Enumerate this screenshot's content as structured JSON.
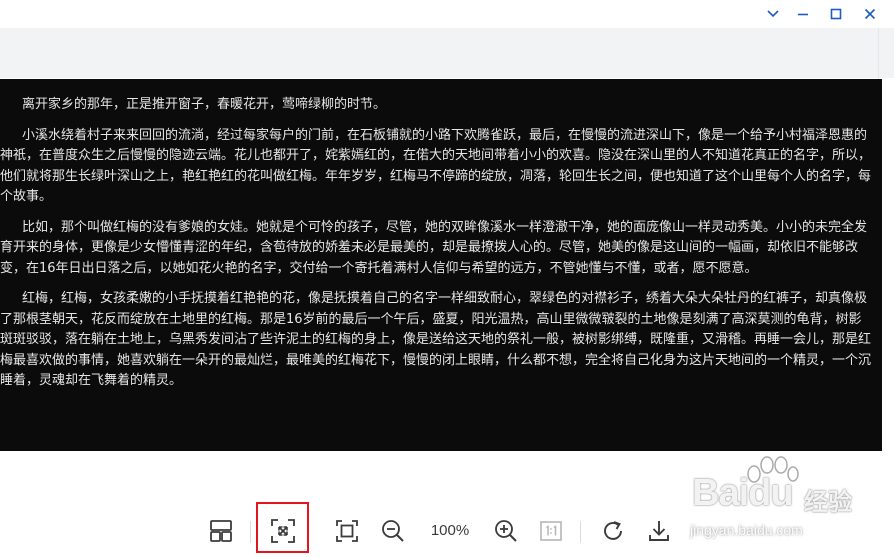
{
  "window": {
    "buttons": [
      "collapse",
      "minimize",
      "maximize",
      "close"
    ]
  },
  "image_text": {
    "paragraphs": [
      "离开家乡的那年，正是推开窗子，春暖花开，莺啼绿柳的时节。",
      "小溪水绕着村子来来回回的流淌，经过每家每户的门前，在石板铺就的小路下欢腾雀跃，最后，在慢慢的流进深山下，像是一个给予小村福泽恩惠的神祇，在普度众生之后慢慢的隐迹云端。花儿也都开了，姹紫嫣红的，在偌大的天地间带着小小的欢喜。隐没在深山里的人不知道花真正的名字，所以，他们就将那生长绿叶深山之上，艳红艳红的花叫做红梅。年年岁岁，红梅马不停蹄的绽放，凋落，轮回生长之间，便也知道了这个山里每个人的名字，每个故事。",
      "比如，那个叫做红梅的没有爹娘的女娃。她就是个可怜的孩子，尽管，她的双眸像溪水一样澄澈干净，她的面庞像山一样灵动秀美。小小的未完全发育开来的身体，更像是少女懵懂青涩的年纪，含苞待放的娇羞未必是最美的，却是最撩拨人心的。尽管，她美的像是这山间的一幅画，却依旧不能够改变，在16年日出日落之后，以她如花火艳的名字，交付给一个寄托着满村人信仰与希望的远方，不管她懂与不懂，或者，愿不愿意。",
      "红梅，红梅，女孩柔嫩的小手抚摸着红艳艳的花，像是抚摸着自己的名字一样细致耐心，翠绿色的对襟衫子，绣着大朵大朵牡丹的红裤子，却真像极了那根茎朝天，花反而绽放在土地里的红梅。那是16岁前的最后一个午后，盛夏，阳光温热，高山里微微皲裂的土地像是刻满了高深莫测的龟背，树影斑斑驳驳，落在躺在土地上，乌黑秀发间沾了些许泥土的红梅的身上，像是送给这天地的祭礼一般，被树影绑缚，既隆重，又滑稽。再睡一会儿，那是红梅最喜欢做的事情，她喜欢躺在一朵开的最灿烂，最唯美的红梅花下，慢慢的闭上眼睛，什么都不想，完全将自己化身为这片天地间的一个精灵，一个沉睡着，灵魂却在飞舞着的精灵。"
    ]
  },
  "toolbar": {
    "zoom_level": "100%",
    "icons": [
      "layout-icon",
      "fit-screen-icon",
      "fullscreen-icon",
      "zoom-out-icon",
      "zoom-in-icon",
      "actual-size-icon",
      "rotate-icon",
      "download-icon"
    ],
    "highlight_color": "#e1151b"
  },
  "watermark": {
    "brand": "Bai",
    "brand_suffix": "du",
    "cn": "经验",
    "url": "jingyan.baidu.com"
  },
  "colors": {
    "accent": "#1a73e8",
    "image_bg": "#0b0b0b",
    "toolbar_strip": "#f2f3f5"
  }
}
